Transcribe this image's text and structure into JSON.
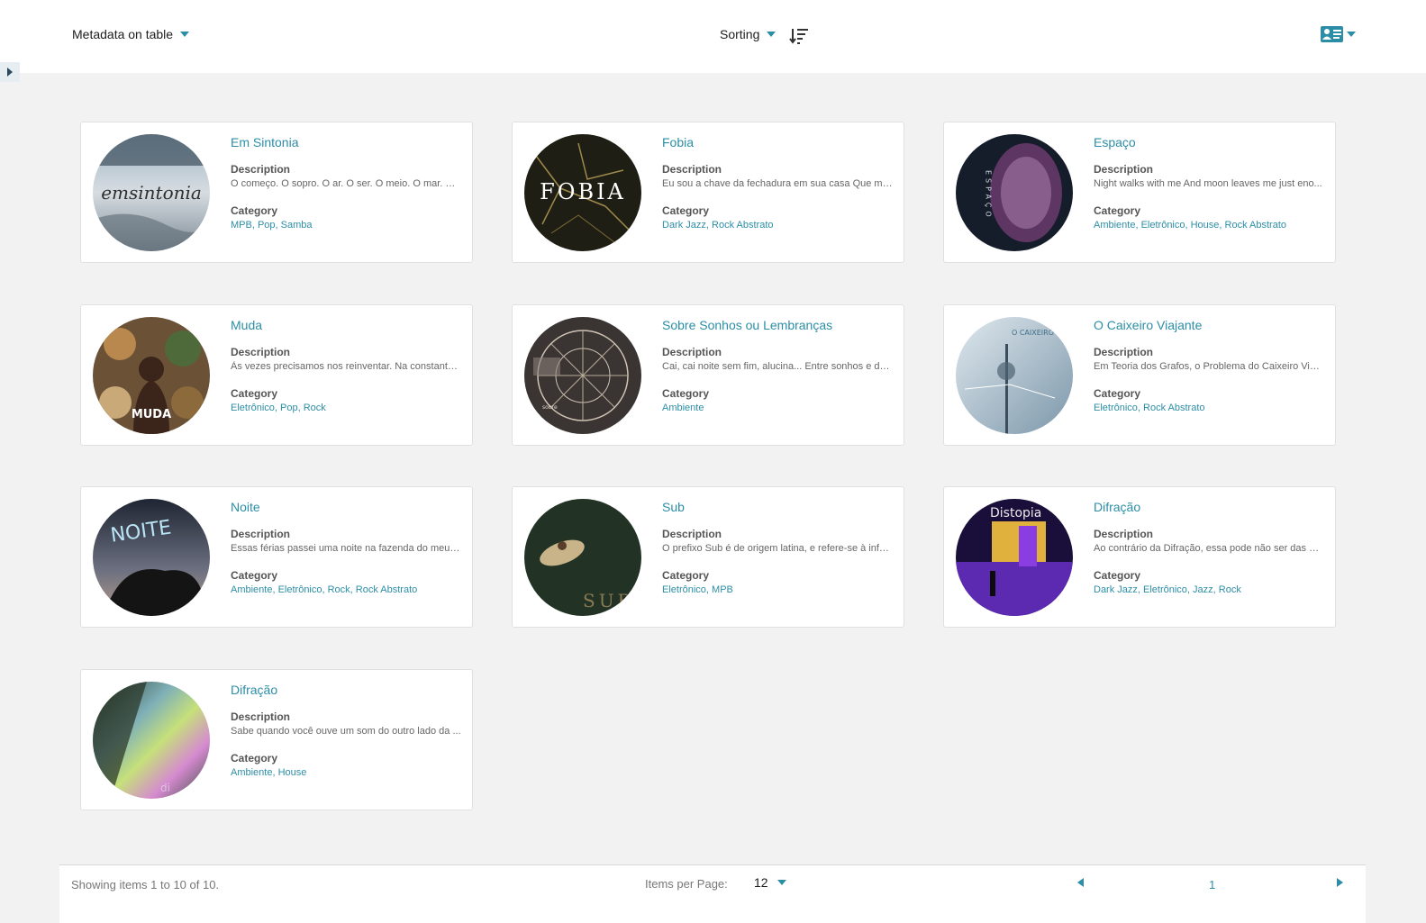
{
  "header": {
    "metadata_label": "Metadata on table",
    "sorting_label": "Sorting",
    "sort_icon": "sort-descending-icon",
    "view_icon": "view-mode-card-icon"
  },
  "colors": {
    "accent": "#2c8ea6",
    "background": "#f2f2f2"
  },
  "labels": {
    "description": "Description",
    "category": "Category"
  },
  "items": [
    {
      "title": "Em Sintonia",
      "description": "O começo. O sopro. O ar. O ser. O meio. O mar. O h...",
      "category": "MPB, Pop, Samba",
      "thumb_text": "emsintonia"
    },
    {
      "title": "Fobia",
      "description": "Eu sou a chave da fechadura em sua casa Que ma...",
      "category": "Dark Jazz, Rock Abstrato",
      "thumb_text": "FOBIA"
    },
    {
      "title": "Espaço",
      "description": "Night walks with me And moon leaves me just eno...",
      "category": "Ambiente, Eletrônico, House, Rock Abstrato",
      "thumb_text": "ESPAÇO"
    },
    {
      "title": "Muda",
      "description": "Às vezes precisamos nos reinventar. Na constante ...",
      "category": "Eletrônico, Pop, Rock",
      "thumb_text": "MUDA"
    },
    {
      "title": "Sobre Sonhos ou Lembranças",
      "description": "Cai, cai noite sem fim, alucina... Entre sonhos e delir...",
      "category": "Ambiente",
      "thumb_text": "sobre"
    },
    {
      "title": "O Caixeiro Viajante",
      "description": "Em Teoria dos Grafos, o Problema do Caixeiro Viaj...",
      "category": "Eletrônico, Rock Abstrato",
      "thumb_text": "O CAIXEIRO VIAJANTE"
    },
    {
      "title": "Noite",
      "description": "Essas férias passei uma noite na fazenda do meu v...",
      "category": "Ambiente, Eletrônico, Rock, Rock Abstrato",
      "thumb_text": "NOITE"
    },
    {
      "title": "Sub",
      "description": "O prefixo Sub é de origem latina, e refere-se à inferi...",
      "category": "Eletrônico, MPB",
      "thumb_text": "SUB"
    },
    {
      "title": "Difração",
      "description": "Ao contrário da Difração, essa pode não ser das m...",
      "category": "Dark Jazz, Eletrônico, Jazz, Rock",
      "thumb_text": "Distopia"
    },
    {
      "title": "Difração",
      "description": "Sabe quando você ouve um som do outro lado da ...",
      "category": "Ambiente, House",
      "thumb_text": "di"
    }
  ],
  "footer": {
    "showing_text": "Showing items 1 to 10 of 10.",
    "items_per_page_label": "Items per Page:",
    "items_per_page_value": "12",
    "current_page": "1"
  }
}
